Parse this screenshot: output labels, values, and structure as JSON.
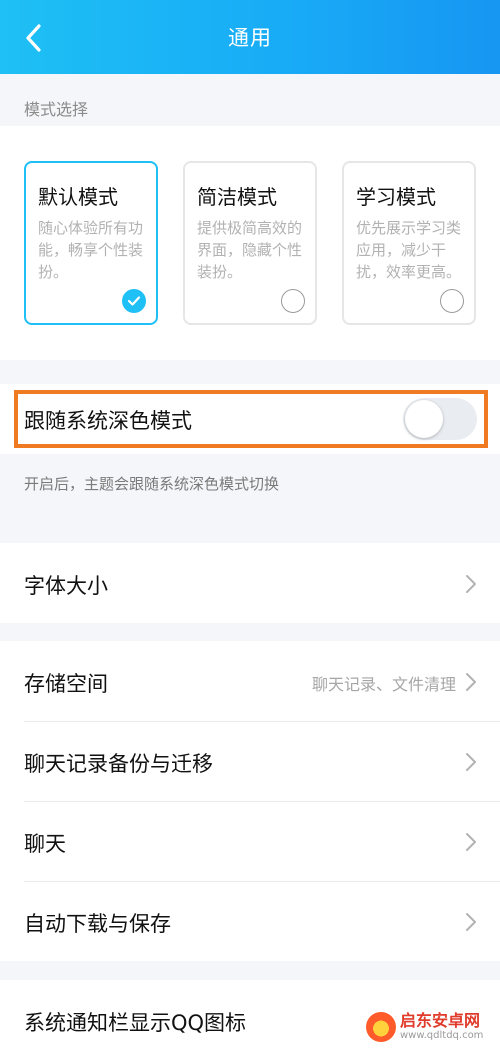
{
  "header": {
    "title": "通用"
  },
  "mode_section": {
    "label": "模式选择",
    "modes": [
      {
        "title": "默认模式",
        "description": "随心体验所有功能，畅享个性装扮。",
        "selected": true
      },
      {
        "title": "简洁模式",
        "description": "提供极简高效的界面，隐藏个性装扮。",
        "selected": false
      },
      {
        "title": "学习模式",
        "description": "优先展示学习类应用，减少干扰，效率更高。",
        "selected": false
      }
    ]
  },
  "dark_mode": {
    "label": "跟随系统深色模式",
    "enabled": false,
    "hint": "开启后，主题会跟随系统深色模式切换"
  },
  "font_size": {
    "label": "字体大小"
  },
  "settings": [
    {
      "label": "存储空间",
      "value": "聊天记录、文件清理"
    },
    {
      "label": "聊天记录备份与迁移",
      "value": ""
    },
    {
      "label": "聊天",
      "value": ""
    },
    {
      "label": "自动下载与保存",
      "value": ""
    }
  ],
  "notification": {
    "label": "系统通知栏显示QQ图标"
  },
  "watermark": {
    "name": "启东安卓网",
    "url": "www.qdltdq.com"
  },
  "colors": {
    "header_start": "#1ec0f5",
    "header_end": "#1796f2",
    "accent": "#1ec0f5",
    "highlight": "#f07a22"
  },
  "icons": {
    "back": "chevron-left-icon",
    "check": "check-icon",
    "row_arrow": "chevron-right-icon"
  }
}
